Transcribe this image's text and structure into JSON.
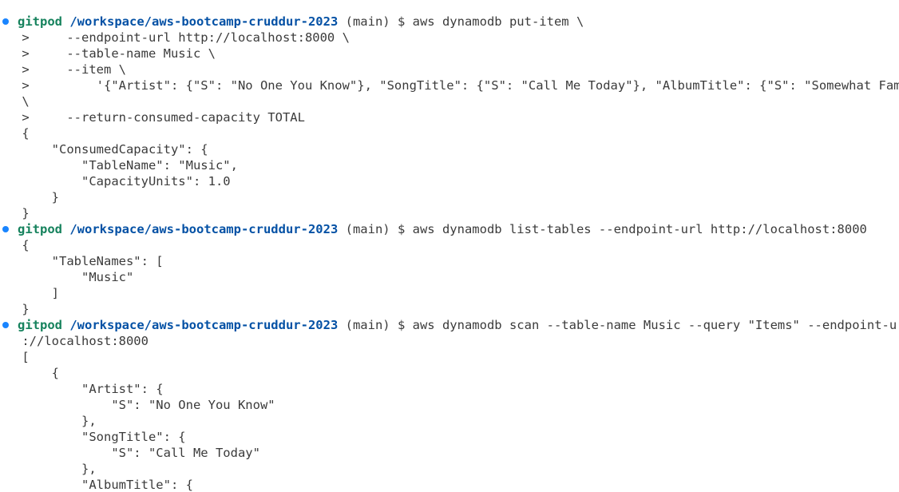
{
  "theme": {
    "prompt_user_color": "#16825d",
    "prompt_path_color": "#0451a5",
    "text_color": "#3b3b3b",
    "success_dot_color": "#1a85ff"
  },
  "prompt": {
    "user": "gitpod",
    "path": "/workspace/aws-bootcamp-cruddur-2023",
    "branch": "(main) $"
  },
  "lines": [
    {
      "type": "prompt",
      "command": "aws dynamodb put-item \\"
    },
    {
      "type": "output",
      "text": " >     --endpoint-url http://localhost:8000 \\"
    },
    {
      "type": "output",
      "text": " >     --table-name Music \\"
    },
    {
      "type": "output",
      "text": " >     --item \\"
    },
    {
      "type": "output",
      "text": " >         '{\"Artist\": {\"S\": \"No One You Know\"}, \"SongTitle\": {\"S\": \"Call Me Today\"}, \"AlbumTitle\": {\"S\": \"Somewhat Famous\"}}'"
    },
    {
      "type": "output",
      "text": " \\"
    },
    {
      "type": "output",
      "text": " >     --return-consumed-capacity TOTAL"
    },
    {
      "type": "output",
      "text": " {"
    },
    {
      "type": "output",
      "text": "     \"ConsumedCapacity\": {"
    },
    {
      "type": "output",
      "text": "         \"TableName\": \"Music\","
    },
    {
      "type": "output",
      "text": "         \"CapacityUnits\": 1.0"
    },
    {
      "type": "output",
      "text": "     }"
    },
    {
      "type": "output",
      "text": " }"
    },
    {
      "type": "prompt",
      "command": "aws dynamodb list-tables --endpoint-url http://localhost:8000"
    },
    {
      "type": "output",
      "text": " {"
    },
    {
      "type": "output",
      "text": "     \"TableNames\": ["
    },
    {
      "type": "output",
      "text": "         \"Music\""
    },
    {
      "type": "output",
      "text": "     ]"
    },
    {
      "type": "output",
      "text": " }"
    },
    {
      "type": "prompt",
      "command": "aws dynamodb scan --table-name Music --query \"Items\" --endpoint-url ht"
    },
    {
      "type": "output",
      "text": " ://localhost:8000"
    },
    {
      "type": "output",
      "text": " ["
    },
    {
      "type": "output",
      "text": "     {"
    },
    {
      "type": "output",
      "text": "         \"Artist\": {"
    },
    {
      "type": "output",
      "text": "             \"S\": \"No One You Know\""
    },
    {
      "type": "output",
      "text": "         },"
    },
    {
      "type": "output",
      "text": "         \"SongTitle\": {"
    },
    {
      "type": "output",
      "text": "             \"S\": \"Call Me Today\""
    },
    {
      "type": "output",
      "text": "         },"
    },
    {
      "type": "output",
      "text": "         \"AlbumTitle\": {"
    }
  ]
}
